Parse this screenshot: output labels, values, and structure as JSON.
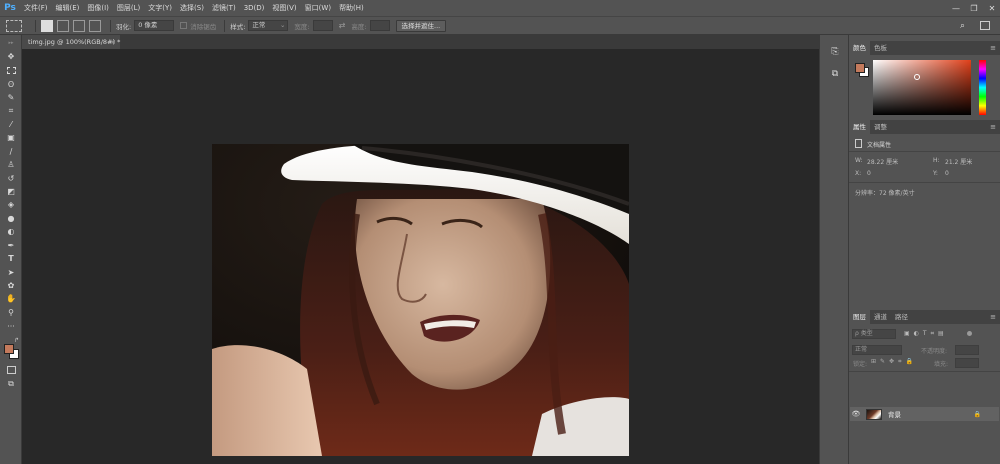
{
  "app": {
    "logo": "Ps"
  },
  "menu": [
    "文件(F)",
    "编辑(E)",
    "图像(I)",
    "图层(L)",
    "文字(Y)",
    "选择(S)",
    "滤镜(T)",
    "3D(D)",
    "视图(V)",
    "窗口(W)",
    "帮助(H)"
  ],
  "window_controls": {
    "minimize": "—",
    "restore": "❐",
    "close": "✕"
  },
  "options": {
    "feather_label": "羽化:",
    "feather_value": "0 像素",
    "antialias_label": "消除锯齿",
    "style_label": "样式:",
    "style_value": "正常",
    "width_label": "宽度:",
    "height_label": "高度:",
    "select_mask_button": "选择并遮住..."
  },
  "document": {
    "tab_label": "timg.jpg @ 100%(RGB/8#) *",
    "close_glyph": "×"
  },
  "panels": {
    "color": {
      "tabs": [
        "颜色",
        "色板"
      ]
    },
    "properties": {
      "tabs": [
        "属性",
        "调整"
      ],
      "section_title": "文档属性",
      "w_label": "W:",
      "w_value": "28.22 厘米",
      "h_label": "H:",
      "h_value": "21.2 厘米",
      "x_label": "X:",
      "x_value": "0",
      "y_label": "Y:",
      "y_value": "0",
      "resolution": "分辨率：72 像素/英寸"
    },
    "layers": {
      "tabs": [
        "图层",
        "通道",
        "路径"
      ],
      "filter_label": "ρ 类型",
      "blend_mode": "正常",
      "opacity_label": "不透明度:",
      "lock_label": "锁定:",
      "fill_label": "填充:",
      "layer_name": "背景"
    }
  },
  "colors": {
    "foreground": "#c47a5c",
    "background": "#ffffff",
    "picker_hue": "#e0401a",
    "accent_blue": "#4fb0ff"
  },
  "icons": {
    "tools": [
      "move-icon",
      "marquee-icon",
      "lasso-icon",
      "quick-select-icon",
      "crop-icon",
      "eyedropper-icon",
      "healing-brush-icon",
      "brush-icon",
      "stamp-icon",
      "history-brush-icon",
      "eraser-icon",
      "paint-bucket-icon",
      "blur-icon",
      "dodge-icon",
      "pen-icon",
      "type-icon",
      "path-select-icon",
      "shape-icon",
      "hand-icon",
      "zoom-icon",
      "more-tools-icon"
    ]
  }
}
